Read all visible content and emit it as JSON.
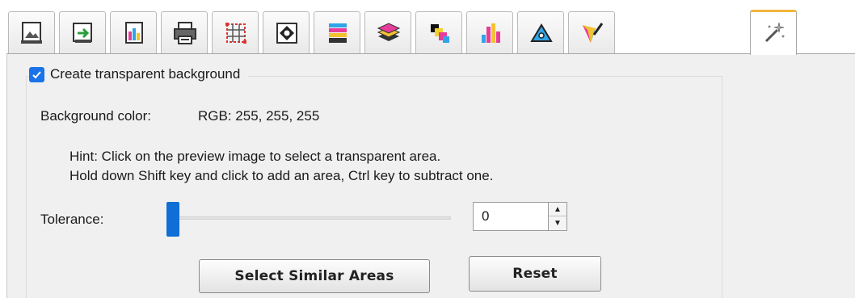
{
  "tabs": [
    {
      "icon": "image-document-icon",
      "active": false
    },
    {
      "icon": "export-arrow-icon",
      "active": false
    },
    {
      "icon": "color-image-icon",
      "active": false
    },
    {
      "icon": "printer-icon",
      "active": false
    },
    {
      "icon": "crop-grid-icon",
      "active": false
    },
    {
      "icon": "sharpen-icon",
      "active": false
    },
    {
      "icon": "color-bars-icon",
      "active": false
    },
    {
      "icon": "layers-icon",
      "active": false
    },
    {
      "icon": "cmyk-overlap-icon",
      "active": false
    },
    {
      "icon": "cmyk-channels-icon",
      "active": false
    },
    {
      "icon": "tone-curve-icon",
      "active": false
    },
    {
      "icon": "color-picker-icon",
      "active": false
    },
    {
      "icon": "magic-wand-icon",
      "active": true
    }
  ],
  "transparency": {
    "checkbox_label": "Create transparent background",
    "checked": true,
    "bg_color_label": "Background color:",
    "bg_color_value": "RGB: 255, 255, 255",
    "hint_line1": "Hint: Click on the preview image to select a transparent area.",
    "hint_line2": "Hold down Shift key and click to add an area, Ctrl key to subtract one.",
    "tolerance_label": "Tolerance:",
    "tolerance_value": "0",
    "select_similar_label": "Select Similar Areas",
    "reset_label": "Reset"
  },
  "colors": {
    "accent": "#1a73e8",
    "slider_thumb": "#0f6fd6",
    "active_tab_border": "#f2b63a"
  }
}
